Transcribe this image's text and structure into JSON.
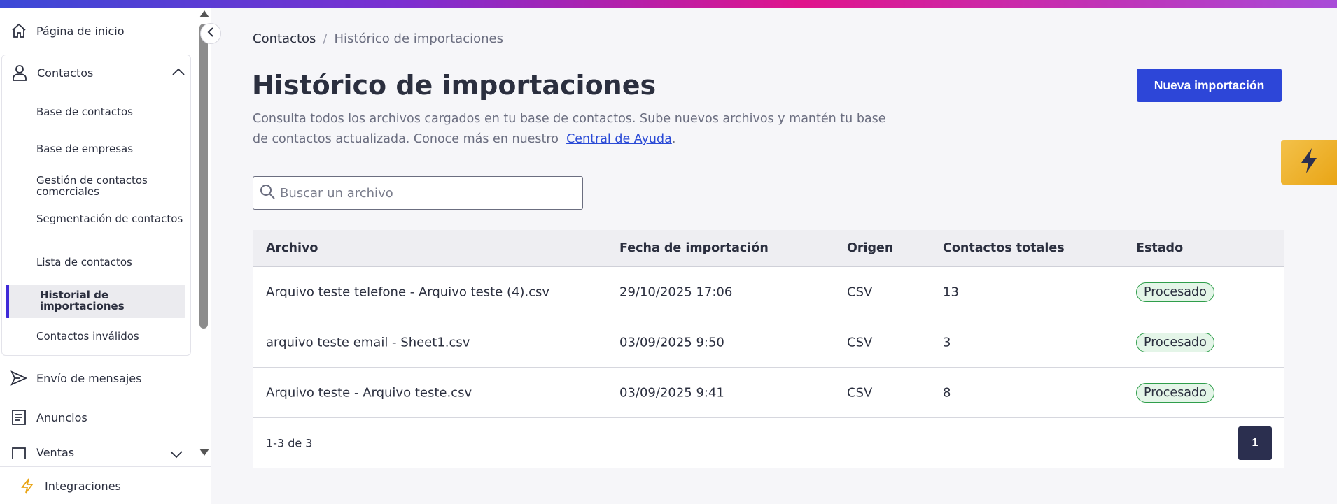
{
  "sidebar": {
    "home_label": "Página de inicio",
    "contacts_group": {
      "label": "Contactos",
      "items": [
        {
          "label": "Base de contactos"
        },
        {
          "label": "Base de empresas"
        },
        {
          "label": "Gestión de contactos comerciales"
        },
        {
          "label": "Segmentación de contactos"
        },
        {
          "label": "Lista de contactos"
        },
        {
          "label": "Historial de importaciones",
          "active": true
        },
        {
          "label": "Contactos inválidos"
        }
      ]
    },
    "messages_label": "Envío de mensajes",
    "ads_label": "Anuncios",
    "sales_label": "Ventas",
    "integrations_label": "Integraciones",
    "active_color": "#3f2ad8"
  },
  "breadcrumb": {
    "parent": "Contactos",
    "separator": "/",
    "current": "Histórico de importaciones"
  },
  "page": {
    "title": "Histórico de importaciones",
    "description": "Consulta todos los archivos cargados en tu base de contactos. Sube nuevos archivos y mantén tu base de contactos actualizada. Conoce más en nuestro",
    "help_link": "Central de Ayuda",
    "description_end": ".",
    "new_import_button": "Nueva importación"
  },
  "search": {
    "placeholder": "Buscar un archivo",
    "value": ""
  },
  "table": {
    "columns": [
      "Archivo",
      "Fecha de importación",
      "Origen",
      "Contactos totales",
      "Estado"
    ],
    "rows": [
      {
        "file": "Arquivo teste telefone - Arquivo teste (4).csv",
        "date": "29/10/2025 17:06",
        "origin": "CSV",
        "total": "13",
        "status": "Procesado"
      },
      {
        "file": "arquivo teste email - Sheet1.csv",
        "date": "03/09/2025 9:50",
        "origin": "CSV",
        "total": "3",
        "status": "Procesado"
      },
      {
        "file": "Arquivo teste - Arquivo teste.csv",
        "date": "03/09/2025 9:41",
        "origin": "CSV",
        "total": "8",
        "status": "Procesado"
      }
    ],
    "range_text": "1-3 de 3",
    "current_page": "1"
  },
  "colors": {
    "primary": "#2d46d8",
    "success": "#2f9e4b",
    "bolt": "#f3c14a"
  }
}
